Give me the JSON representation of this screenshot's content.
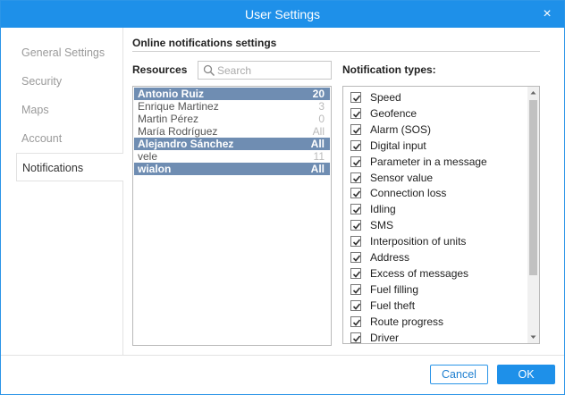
{
  "window": {
    "title": "User Settings",
    "close_glyph": "×",
    "accent": "#1e90e9"
  },
  "sidebar": {
    "items": [
      {
        "label": "General Settings"
      },
      {
        "label": "Security"
      },
      {
        "label": "Maps"
      },
      {
        "label": "Account"
      },
      {
        "label": "Notifications",
        "active": true
      }
    ]
  },
  "main": {
    "section_title": "Online notifications settings",
    "resources_label": "Resources",
    "search": {
      "placeholder": "Search",
      "value": "",
      "icon": "search-icon"
    },
    "resources": [
      {
        "name": "Antonio Ruiz",
        "count": "20",
        "selected": true
      },
      {
        "name": "Enrique Martinez",
        "count": "3",
        "selected": false
      },
      {
        "name": "Martin Pérez",
        "count": "0",
        "selected": false
      },
      {
        "name": "María Rodríguez",
        "count": "All",
        "selected": false
      },
      {
        "name": "Alejandro Sánchez",
        "count": "All",
        "selected": true
      },
      {
        "name": "vele",
        "count": "11",
        "selected": false
      },
      {
        "name": "wialon",
        "count": "All",
        "selected": true
      }
    ],
    "selected_color": "#6f8db2",
    "types_label": "Notification types:",
    "types": [
      {
        "label": "Speed",
        "checked": true
      },
      {
        "label": "Geofence",
        "checked": true
      },
      {
        "label": "Alarm (SOS)",
        "checked": true
      },
      {
        "label": "Digital input",
        "checked": true
      },
      {
        "label": "Parameter in a message",
        "checked": true
      },
      {
        "label": "Sensor value",
        "checked": true
      },
      {
        "label": "Connection loss",
        "checked": true
      },
      {
        "label": "Idling",
        "checked": true
      },
      {
        "label": "SMS",
        "checked": true
      },
      {
        "label": "Interposition of units",
        "checked": true
      },
      {
        "label": "Address",
        "checked": true
      },
      {
        "label": "Excess of messages",
        "checked": true
      },
      {
        "label": "Fuel filling",
        "checked": true
      },
      {
        "label": "Fuel theft",
        "checked": true
      },
      {
        "label": "Route progress",
        "checked": true
      },
      {
        "label": "Driver",
        "checked": true
      }
    ]
  },
  "footer": {
    "cancel_label": "Cancel",
    "ok_label": "OK"
  }
}
